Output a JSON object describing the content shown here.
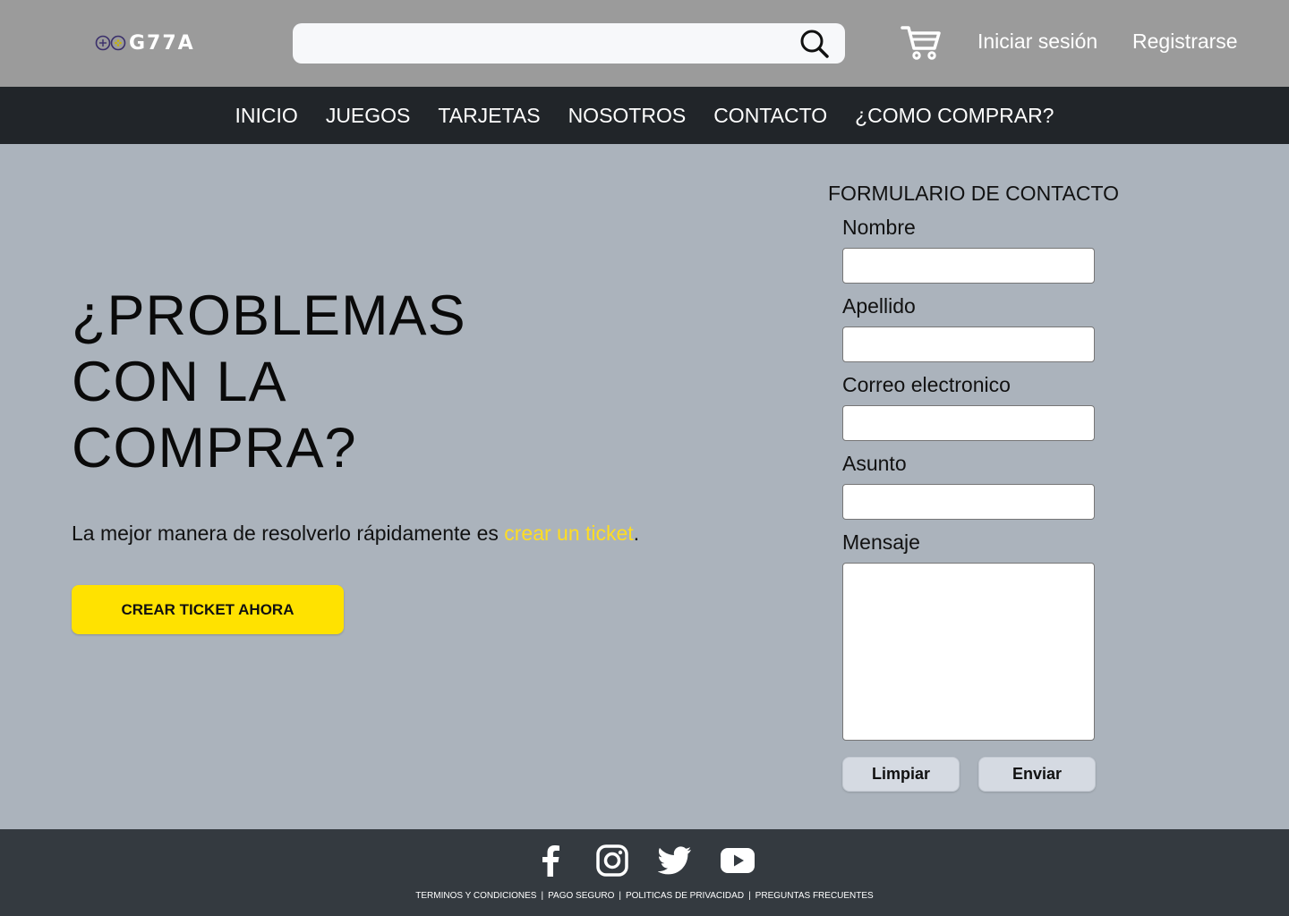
{
  "header": {
    "logo_text": "G77A",
    "logo_icon": "gamepad-icon",
    "search": {
      "value": "",
      "placeholder": "",
      "icon": "search-icon"
    },
    "cart_icon": "cart-icon",
    "login_label": "Iniciar sesión",
    "register_label": "Registrarse"
  },
  "nav": {
    "items": [
      {
        "label": "INICIO"
      },
      {
        "label": "JUEGOS"
      },
      {
        "label": "TARJETAS"
      },
      {
        "label": "NOSOTROS"
      },
      {
        "label": "CONTACTO"
      },
      {
        "label": "¿COMO COMPRAR?"
      }
    ]
  },
  "hero": {
    "title": "¿PROBLEMAS CON LA COMPRA?",
    "text_before": "La mejor manera de resolverlo rápidamente es ",
    "text_link": "crear un ticket",
    "text_after": ".",
    "cta_label": "CREAR TICKET AHORA"
  },
  "form": {
    "title": "FORMULARIO DE CONTACTO",
    "fields": [
      {
        "label": "Nombre",
        "value": ""
      },
      {
        "label": "Apellido",
        "value": ""
      },
      {
        "label": "Correo electronico",
        "value": ""
      },
      {
        "label": "Asunto",
        "value": ""
      }
    ],
    "message": {
      "label": "Mensaje",
      "value": ""
    },
    "clear_label": "Limpiar",
    "submit_label": "Enviar"
  },
  "footer": {
    "social": [
      {
        "icon": "facebook-icon"
      },
      {
        "icon": "instagram-icon"
      },
      {
        "icon": "twitter-icon"
      },
      {
        "icon": "youtube-icon"
      }
    ],
    "links": [
      {
        "label": "TERMINOS Y CONDICIONES"
      },
      {
        "label": "PAGO SEGURO"
      },
      {
        "label": "POLITICAS DE PRIVACIDAD"
      },
      {
        "label": "PREGUNTAS FRECUENTES"
      }
    ],
    "separator": "|"
  },
  "colors": {
    "header_bg": "#9b9b9b",
    "nav_bg": "#212529",
    "page_bg": "#abb3bc",
    "accent_yellow": "#ffe200",
    "footer_bg": "#343a40"
  }
}
